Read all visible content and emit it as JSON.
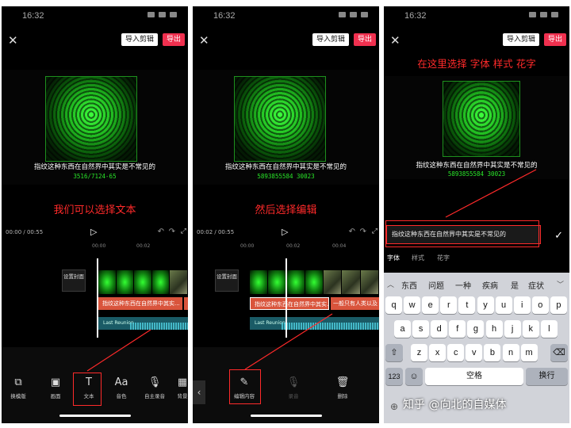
{
  "time": "16:32",
  "topbar": {
    "import_label": "导入剪辑",
    "export_label": "导出"
  },
  "subtitle": "指纹这种东西在自然界中其实是不常见的",
  "code_text_1": "3516/7124-65",
  "code_text_2": "5893855584 30023",
  "screen1": {
    "annotation": "我们可以选择文本",
    "timecode": "00:00 / 00:55",
    "ruler": [
      "00:00",
      "00:02"
    ],
    "cover_label": "设置封面",
    "text_clip": "指纹这种东西在自然界中其实...",
    "audio_label": "Last Reunion",
    "tools": [
      "换模版",
      "画面",
      "文本",
      "音色",
      "自主录音",
      "背景"
    ]
  },
  "screen2": {
    "annotation": "然后选择编辑",
    "timecode": "00:02 / 00:55",
    "ruler": [
      "00:00",
      "00:02",
      "00:04"
    ],
    "cover_label": "设置封面",
    "text_clip": "指纹这种东西在自然界中其实...",
    "text_clip_2": "一般只有人类以及",
    "audio_label": "Last Reunion",
    "tools": [
      "编辑内容",
      "录音",
      "删除"
    ]
  },
  "screen3": {
    "annotation": "在这里选择 字体 样式 花字",
    "edit_text": "指纹这种东西在自然界中其实是不常见的",
    "tabs": [
      "字体",
      "样式",
      "花字"
    ],
    "candidates": [
      "东西",
      "问题",
      "一种",
      "疾病",
      "是",
      "症状"
    ],
    "row1": [
      "q",
      "w",
      "e",
      "r",
      "t",
      "y",
      "u",
      "i",
      "o",
      "p"
    ],
    "row2": [
      "a",
      "s",
      "d",
      "f",
      "g",
      "h",
      "j",
      "k",
      "l"
    ],
    "row3": [
      "z",
      "x",
      "c",
      "v",
      "b",
      "n",
      "m"
    ],
    "num_key": "123",
    "space_key": "空格",
    "return_key": "换行",
    "watermark": "知乎 @向北的自媒体"
  }
}
